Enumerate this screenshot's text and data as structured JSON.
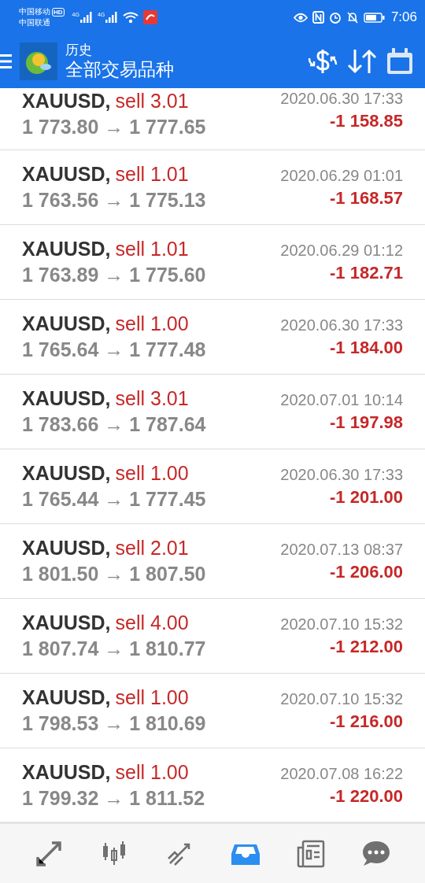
{
  "status_bar": {
    "carriers": [
      "中国移动",
      "中国联通"
    ],
    "hd_badge": "HD",
    "network_labels": [
      "4G",
      "4G"
    ],
    "time": "7:06"
  },
  "toolbar": {
    "title": "历史",
    "subtitle": "全部交易品种"
  },
  "deals": [
    {
      "symbol": "XAUUSD,",
      "side": "sell 3.01",
      "prices": "1 773.80 → 1 777.65",
      "time": "2020.06.30 17:33",
      "profit": "-1 158.85"
    },
    {
      "symbol": "XAUUSD,",
      "side": "sell 1.01",
      "prices": "1 763.56 → 1 775.13",
      "time": "2020.06.29 01:01",
      "profit": "-1 168.57"
    },
    {
      "symbol": "XAUUSD,",
      "side": "sell 1.01",
      "prices": "1 763.89 → 1 775.60",
      "time": "2020.06.29 01:12",
      "profit": "-1 182.71"
    },
    {
      "symbol": "XAUUSD,",
      "side": "sell 1.00",
      "prices": "1 765.64 → 1 777.48",
      "time": "2020.06.30 17:33",
      "profit": "-1 184.00"
    },
    {
      "symbol": "XAUUSD,",
      "side": "sell 3.01",
      "prices": "1 783.66 → 1 787.64",
      "time": "2020.07.01 10:14",
      "profit": "-1 197.98"
    },
    {
      "symbol": "XAUUSD,",
      "side": "sell 1.00",
      "prices": "1 765.44 → 1 777.45",
      "time": "2020.06.30 17:33",
      "profit": "-1 201.00"
    },
    {
      "symbol": "XAUUSD,",
      "side": "sell 2.01",
      "prices": "1 801.50 → 1 807.50",
      "time": "2020.07.13 08:37",
      "profit": "-1 206.00"
    },
    {
      "symbol": "XAUUSD,",
      "side": "sell 4.00",
      "prices": "1 807.74 → 1 810.77",
      "time": "2020.07.10 15:32",
      "profit": "-1 212.00"
    },
    {
      "symbol": "XAUUSD,",
      "side": "sell 1.00",
      "prices": "1 798.53 → 1 810.69",
      "time": "2020.07.10 15:32",
      "profit": "-1 216.00"
    },
    {
      "symbol": "XAUUSD,",
      "side": "sell 1.00",
      "prices": "1 799.32 → 1 811.52",
      "time": "2020.07.08 16:22",
      "profit": "-1 220.00"
    }
  ],
  "bottom_nav": [
    {
      "kind": "quotes",
      "selected": false
    },
    {
      "kind": "chart",
      "selected": false
    },
    {
      "kind": "trade",
      "selected": false
    },
    {
      "kind": "history",
      "selected": true
    },
    {
      "kind": "news",
      "selected": false
    },
    {
      "kind": "messages",
      "selected": false
    }
  ]
}
